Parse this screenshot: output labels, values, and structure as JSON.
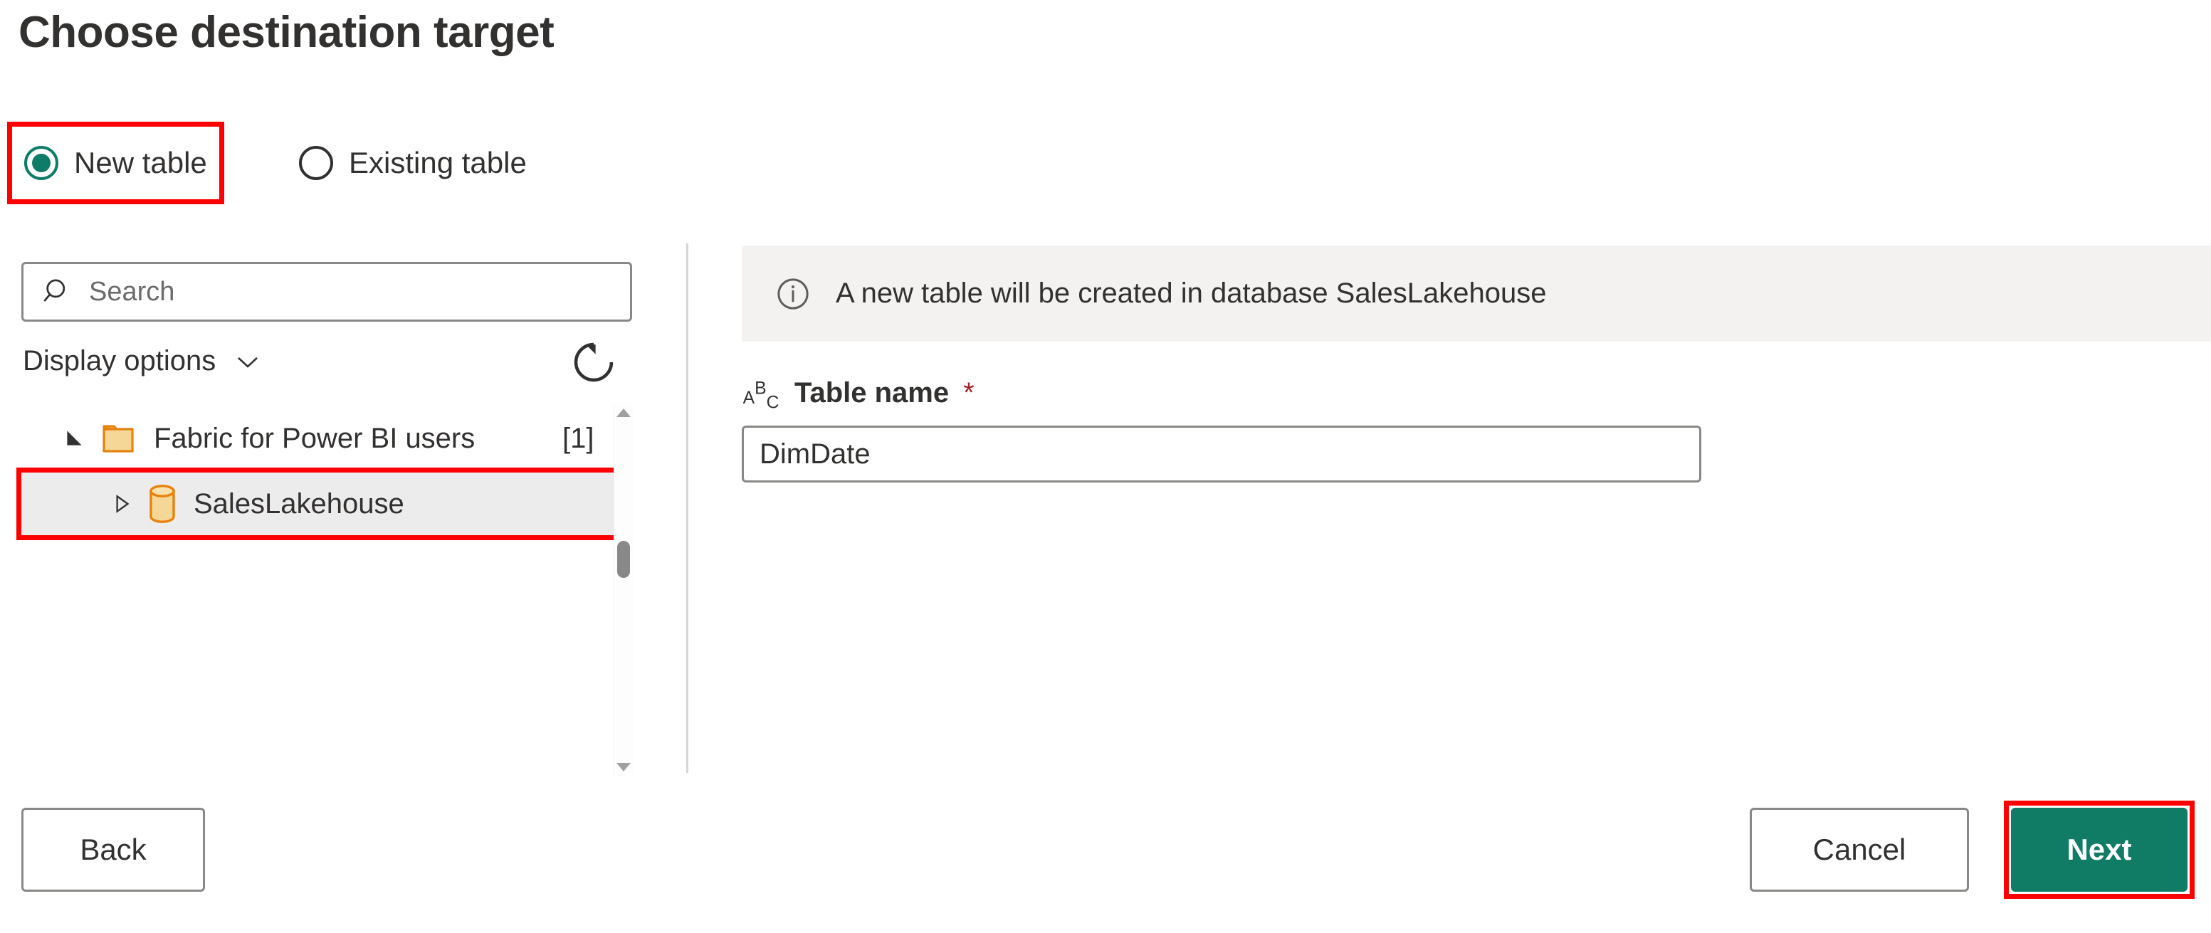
{
  "page": {
    "title": "Choose destination target"
  },
  "target_mode": {
    "options": [
      {
        "label": "New table",
        "selected": true,
        "highlighted": true,
        "icon": "radio-selected-icon"
      },
      {
        "label": "Existing table",
        "selected": false,
        "highlighted": false,
        "icon": "radio-unselected-icon"
      }
    ]
  },
  "left_panel": {
    "search": {
      "placeholder": "Search",
      "value": "",
      "icon": "search-icon"
    },
    "display_options": {
      "label": "Display options",
      "chevron": "chevron-down-icon"
    },
    "refresh": {
      "icon": "refresh-icon",
      "tooltip": "Refresh"
    },
    "tree": [
      {
        "label": "Fabric for Power BI users",
        "count": "[1]",
        "icon": "folder-icon",
        "expander": "expander-expanded-icon",
        "expanded": true,
        "selected": false,
        "highlighted": false,
        "level": 0
      },
      {
        "label": "SalesLakehouse",
        "count": "",
        "icon": "database-icon",
        "expander": "expander-collapsed-icon",
        "expanded": false,
        "selected": true,
        "highlighted": true,
        "level": 1
      }
    ],
    "scrollbar": {
      "up_arrow": "scroll-up-icon",
      "down_arrow": "scroll-down-icon"
    }
  },
  "right_panel": {
    "info_bar": {
      "icon": "info-icon",
      "message": "A new table will be created in database SalesLakehouse"
    },
    "table_name": {
      "icon": "abc-text-type-icon",
      "label": "Table name",
      "required_marker": "*",
      "value": "DimDate",
      "placeholder": ""
    }
  },
  "footer": {
    "back_label": "Back",
    "cancel_label": "Cancel",
    "next_label": "Next"
  },
  "colors": {
    "accent_green": "#107c65",
    "radio_green": "#0e7c66",
    "highlight_red": "#ff0000",
    "required_red": "#a4262c",
    "info_bar_bg": "#f3f2f1",
    "selected_row_bg": "#ececec",
    "folder_orange": "#e8820c",
    "folder_fill": "#f5d898",
    "border_gray": "#8a8886",
    "text_primary": "#323130"
  }
}
